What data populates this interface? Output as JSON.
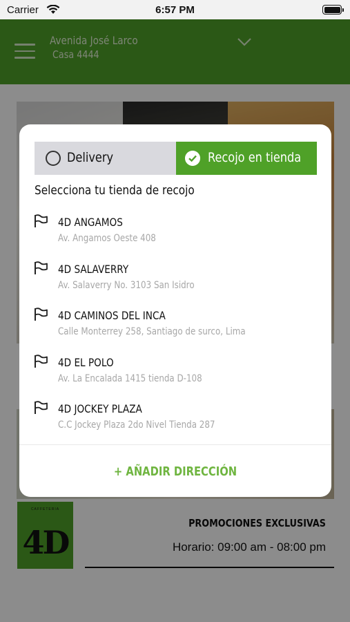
{
  "status_bar": {
    "carrier": "Carrier",
    "time": "6:57 PM"
  },
  "header": {
    "address_street": "Avenida José Larco",
    "address_house": "Casa 4444"
  },
  "modal": {
    "tabs": {
      "delivery_label": "Delivery",
      "pickup_label": "Recojo en tienda",
      "selected": "pickup"
    },
    "subtitle": "Selecciona tu tienda de recojo",
    "stores": [
      {
        "name": "4D ANGAMOS",
        "address": "Av. Angamos Oeste 408"
      },
      {
        "name": "4D SALAVERRY",
        "address": "Av. Salaverry No. 3103 San Isidro"
      },
      {
        "name": "4D CAMINOS DEL INCA",
        "address": "Calle Monterrey 258, Santiago de surco, Lima"
      },
      {
        "name": "4D EL POLO",
        "address": "Av. La Encalada 1415 tienda D-108"
      },
      {
        "name": "4D JOCKEY PLAZA",
        "address": "C.C Jockey Plaza 2do Nivel Tienda 287"
      }
    ],
    "add_address_label": "+ AÑADIR DIRECCIÓN"
  },
  "background": {
    "logo_small": "CAFFETERIA",
    "logo_text": "4D",
    "promo_title": "PROMOCIONES EXCLUSIVAS",
    "schedule": "Horario: 09:00 am - 08:00 pm"
  },
  "colors": {
    "brand_green": "#4fa128",
    "accent_green_text": "#6fb540",
    "tab_inactive": "#d9d9de"
  }
}
